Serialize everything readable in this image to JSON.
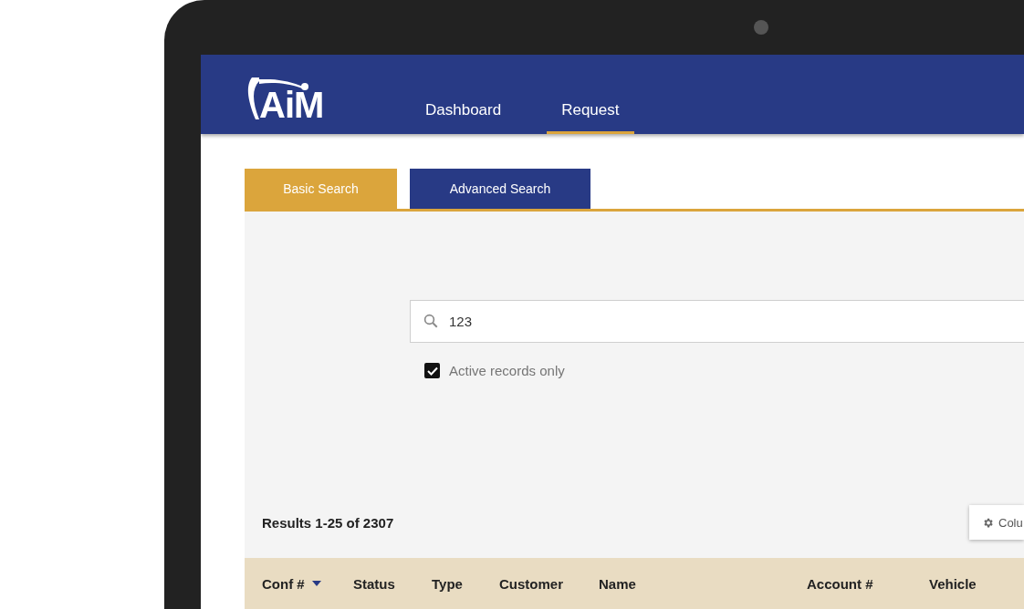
{
  "logo": {
    "text": "AiM"
  },
  "nav": [
    {
      "label": "Dashboard",
      "selected": false
    },
    {
      "label": "Request",
      "selected": true
    }
  ],
  "search_tabs": [
    {
      "label": "Basic Search",
      "selected": true
    },
    {
      "label": "Advanced Search",
      "selected": false
    }
  ],
  "search": {
    "value": "123"
  },
  "active_only": {
    "label": "Active records only",
    "checked": true
  },
  "results": {
    "summary": "Results 1-25 of 2307",
    "columns_button": "Colu"
  },
  "table": {
    "columns": [
      {
        "label": "Conf #",
        "sorted": true
      },
      {
        "label": "Status",
        "sorted": false
      },
      {
        "label": "Type",
        "sorted": false
      },
      {
        "label": "Customer",
        "sorted": false
      },
      {
        "label": "Name",
        "sorted": false
      },
      {
        "label": "Account #",
        "sorted": false
      },
      {
        "label": "Vehicle",
        "sorted": false
      }
    ]
  }
}
